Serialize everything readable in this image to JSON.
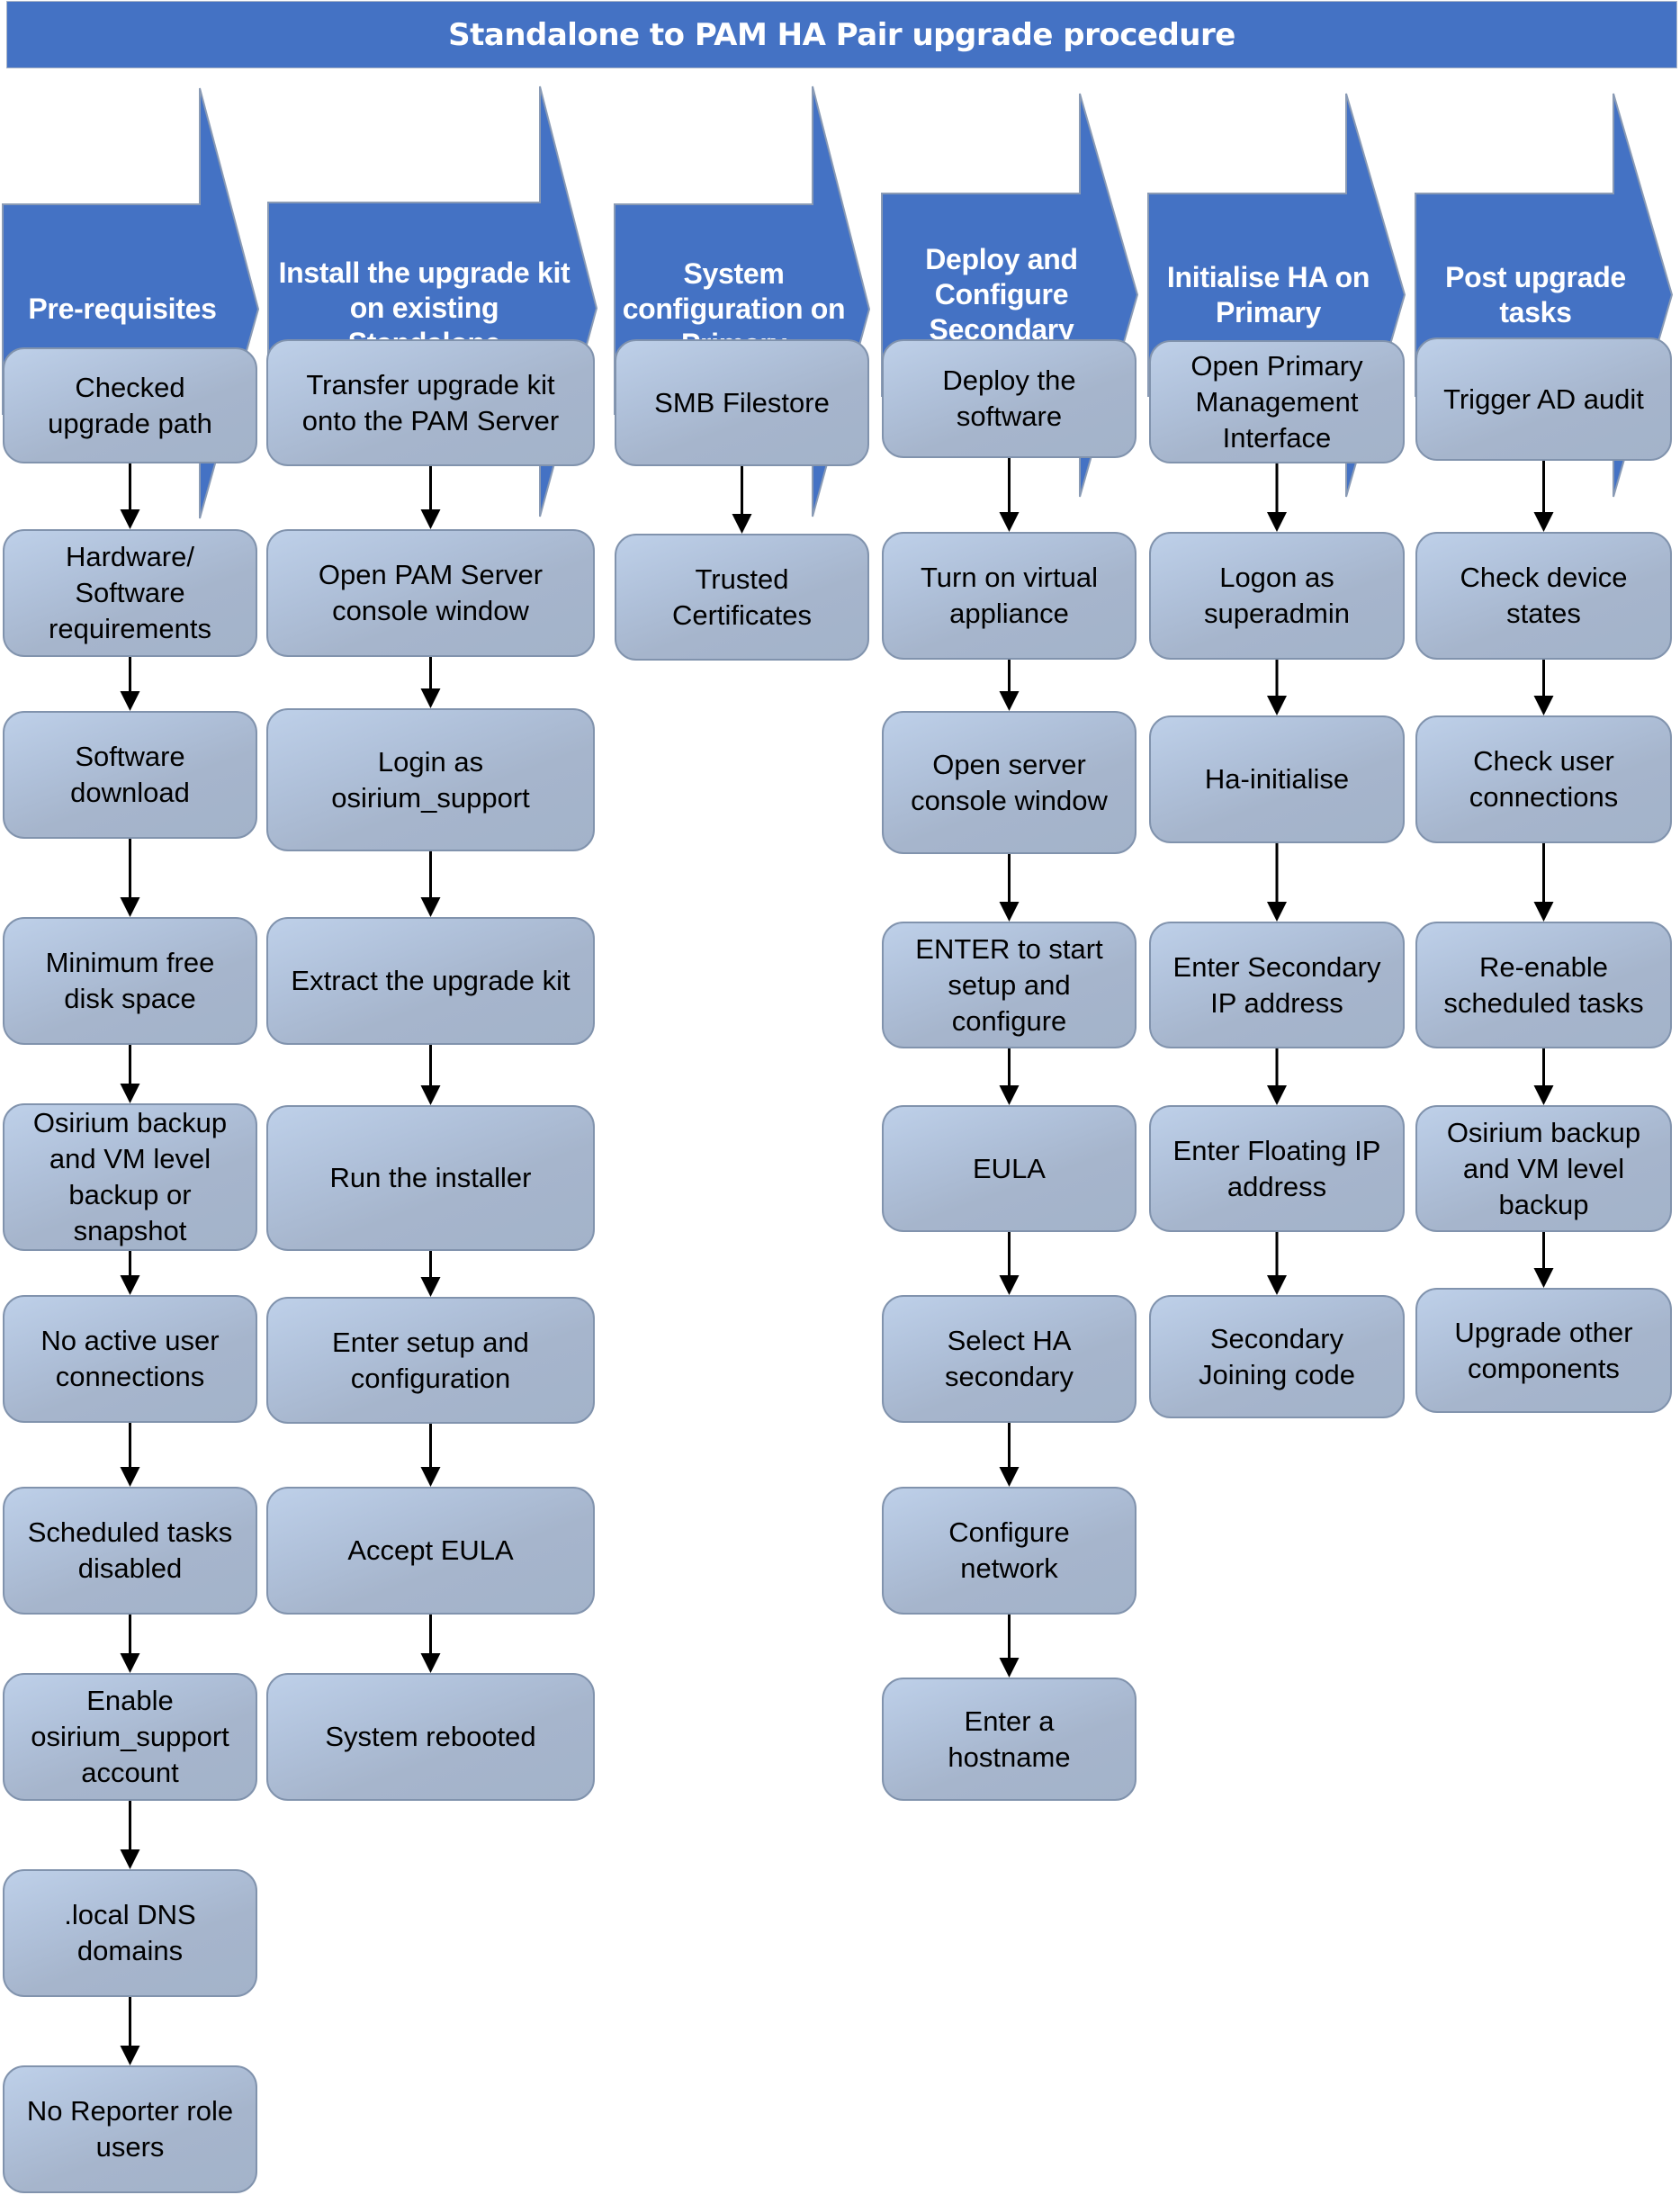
{
  "title": "Standalone to PAM HA Pair upgrade procedure",
  "colors": {
    "phase_fill": "#4472C4",
    "phase_text": "#FFFFFF",
    "step_fill_light": "#BED0E9",
    "step_fill_dark": "#A3B3CA",
    "step_border": "#8193AD",
    "connector": "#000000"
  },
  "phases": [
    {
      "label": "Pre-requisites",
      "steps": [
        "Checked\nupgrade path",
        "Hardware/\nSoftware\nrequirements",
        "Software\ndownload",
        "Minimum free\ndisk space",
        "Osirium backup\nand VM level\nbackup or\nsnapshot",
        "No active user\nconnections",
        "Scheduled tasks\ndisabled",
        "Enable\nosirium_support\naccount",
        ".local DNS\ndomains",
        "No Reporter role\nusers"
      ]
    },
    {
      "label": "Install the upgrade kit on existing Standalone",
      "steps": [
        "Transfer upgrade kit\nonto the PAM Server",
        "Open PAM Server\nconsole window",
        "Login as\nosirium_support",
        "Extract the upgrade kit",
        "Run the installer",
        "Enter setup and\nconfiguration",
        "Accept EULA",
        "System rebooted"
      ]
    },
    {
      "label": "System configuration on Primary",
      "steps": [
        "SMB Filestore",
        "Trusted\nCertificates"
      ]
    },
    {
      "label": "Deploy and Configure Secondary",
      "steps": [
        "Deploy the\nsoftware",
        "Turn on virtual\nappliance",
        "Open server\nconsole window",
        "ENTER to start\nsetup and\nconfigure",
        "EULA",
        "Select HA\nsecondary",
        "Configure\nnetwork",
        "Enter a\nhostname"
      ]
    },
    {
      "label": "Initialise HA on Primary",
      "steps": [
        "Open Primary\nManagement\nInterface",
        "Logon as\nsuperadmin",
        "Ha-initialise",
        "Enter Secondary\nIP address",
        "Enter Floating IP\naddress",
        "Secondary\nJoining code"
      ]
    },
    {
      "label": "Post upgrade tasks",
      "steps": [
        "Trigger AD audit",
        "Check device\nstates",
        "Check user\nconnections",
        "Re-enable\nscheduled tasks",
        "Osirium backup\nand VM level\nbackup",
        "Upgrade other\ncomponents"
      ]
    }
  ]
}
